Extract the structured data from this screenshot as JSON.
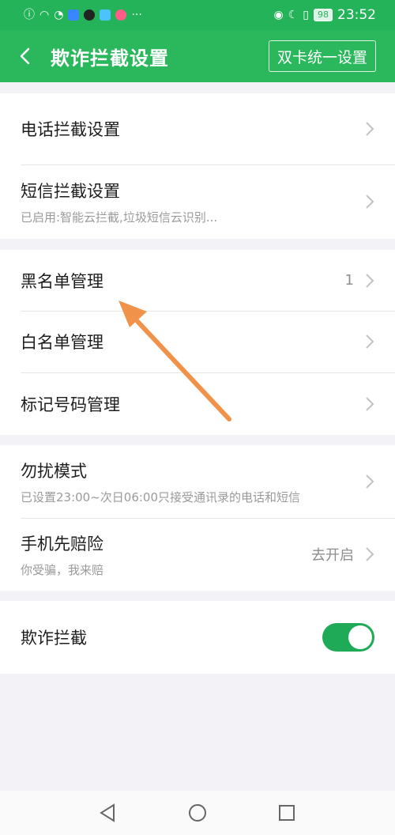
{
  "status_bar": {
    "time": "23:52",
    "battery": "98"
  },
  "header": {
    "title": "欺诈拦截设置",
    "dual_sim_button": "双卡统一设置"
  },
  "sections": [
    {
      "rows": [
        {
          "title": "电话拦截设置"
        },
        {
          "title": "短信拦截设置",
          "subtitle": "已启用:智能云拦截,垃圾短信云识别..."
        }
      ]
    },
    {
      "rows": [
        {
          "title": "黑名单管理",
          "value": "1"
        },
        {
          "title": "白名单管理"
        },
        {
          "title": "标记号码管理"
        }
      ]
    },
    {
      "rows": [
        {
          "title": "勿扰模式",
          "subtitle": "已设置23:00~次日06:00只接受通讯录的电话和短信"
        },
        {
          "title": "手机先赔险",
          "subtitle": "你受骗，我来赔",
          "value": "去开启"
        }
      ]
    },
    {
      "rows": [
        {
          "title": "欺诈拦截",
          "toggle_on": true
        }
      ]
    }
  ],
  "colors": {
    "accent": "#2bb85c",
    "toggle": "#1faa58",
    "arrow": "#f0924a"
  }
}
